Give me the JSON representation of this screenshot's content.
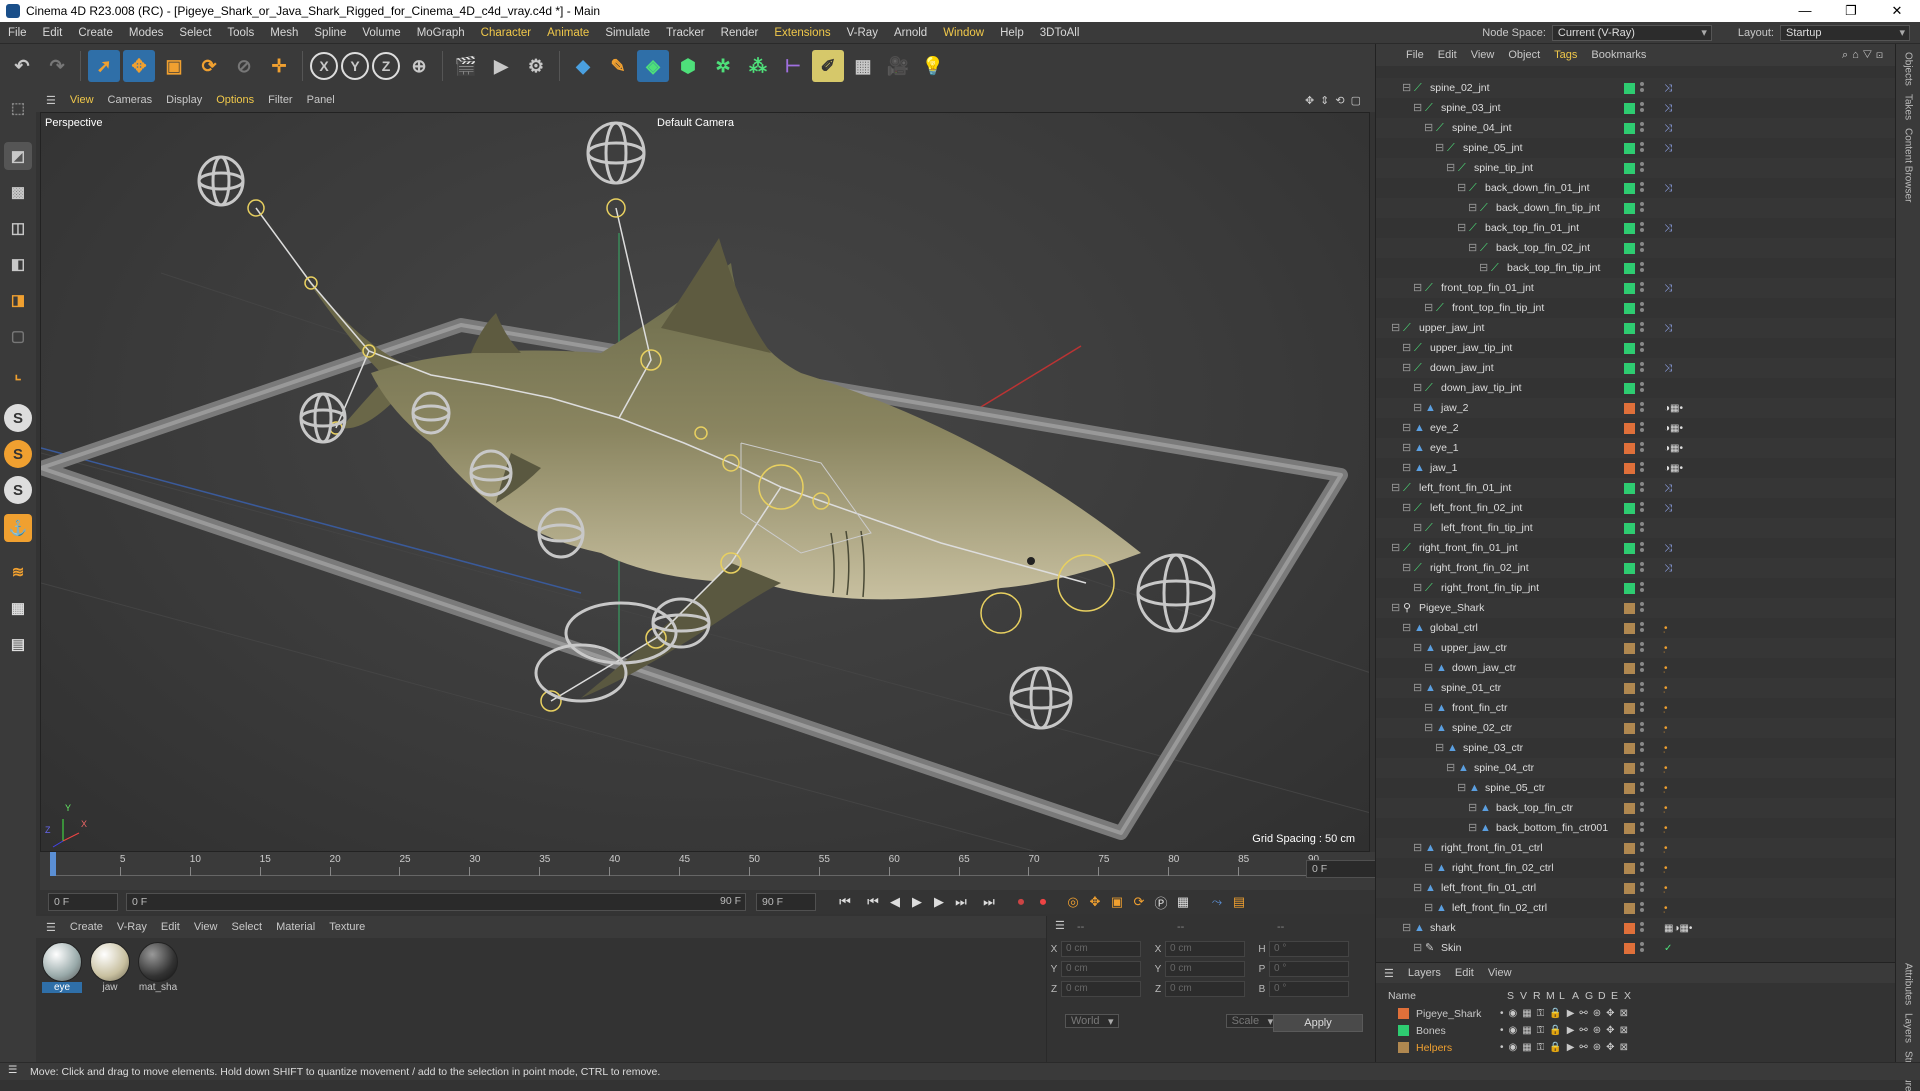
{
  "window": {
    "title": "Cinema 4D R23.008 (RC) - [Pigeye_Shark_or_Java_Shark_Rigged_for_Cinema_4D_c4d_vray.c4d *] - Main",
    "controls": [
      "—",
      "❐",
      "✕"
    ]
  },
  "menubar": {
    "items": [
      "File",
      "Edit",
      "Create",
      "Modes",
      "Select",
      "Tools",
      "Mesh",
      "Spline",
      "Volume",
      "MoGraph",
      "Character",
      "Animate",
      "Simulate",
      "Tracker",
      "Render",
      "Extensions",
      "V-Ray",
      "Arnold",
      "Window",
      "Help",
      "3DToAll"
    ],
    "node_space_label": "Node Space:",
    "node_space_value": "Current (V-Ray)",
    "layout_label": "Layout:",
    "layout_value": "Startup"
  },
  "viewport": {
    "menu": [
      "View",
      "Cameras",
      "Display",
      "Options",
      "Filter",
      "Panel"
    ],
    "name": "Perspective",
    "camera": "Default Camera",
    "grid_spacing": "Grid Spacing : 50 cm",
    "axis_x": "X",
    "axis_y": "Y",
    "axis_z": "Z"
  },
  "timeline": {
    "ticks": [
      "0",
      "5",
      "10",
      "15",
      "20",
      "25",
      "30",
      "35",
      "40",
      "45",
      "50",
      "55",
      "60",
      "65",
      "70",
      "75",
      "80",
      "85",
      "90"
    ],
    "current_frame": "0 F",
    "start": "0 F",
    "range_start": "0 F",
    "range_end": "90 F",
    "end": "90 F"
  },
  "materials": {
    "menu": [
      "Create",
      "V-Ray",
      "Edit",
      "View",
      "Select",
      "Material",
      "Texture"
    ],
    "items": [
      {
        "name": "eye",
        "color": "#cfd8d8"
      },
      {
        "name": "jaw",
        "color": "#d8d0a8"
      },
      {
        "name": "mat_sha",
        "color": "#3a3a3a"
      }
    ]
  },
  "coords": {
    "header": [
      "--",
      "--",
      "--"
    ],
    "rows": [
      {
        "l1": "X",
        "v1": "0 cm",
        "l2": "X",
        "v2": "0 cm",
        "l3": "H",
        "v3": "0 °"
      },
      {
        "l1": "Y",
        "v1": "0 cm",
        "l2": "Y",
        "v2": "0 cm",
        "l3": "P",
        "v3": "0 °"
      },
      {
        "l1": "Z",
        "v1": "0 cm",
        "l2": "Z",
        "v2": "0 cm",
        "l3": "B",
        "v3": "0 °"
      }
    ],
    "world": "World",
    "scale": "Scale",
    "apply": "Apply"
  },
  "objects": {
    "menu": [
      "File",
      "Edit",
      "View",
      "Object",
      "Tags",
      "Bookmarks"
    ],
    "rows": [
      {
        "name": "spine_02_jnt",
        "depth": 2,
        "type": "joint",
        "lay": "#2ecc71",
        "tag": "ik"
      },
      {
        "name": "spine_03_jnt",
        "depth": 3,
        "type": "joint",
        "lay": "#2ecc71",
        "tag": "ik"
      },
      {
        "name": "spine_04_jnt",
        "depth": 4,
        "type": "joint",
        "lay": "#2ecc71",
        "tag": "ik"
      },
      {
        "name": "spine_05_jnt",
        "depth": 5,
        "type": "joint",
        "lay": "#2ecc71",
        "tag": "ik"
      },
      {
        "name": "spine_tip_jnt",
        "depth": 6,
        "type": "joint",
        "lay": "#2ecc71",
        "tag": ""
      },
      {
        "name": "back_down_fin_01_jnt",
        "depth": 7,
        "type": "joint",
        "lay": "#2ecc71",
        "tag": "ik"
      },
      {
        "name": "back_down_fin_tip_jnt",
        "depth": 8,
        "type": "joint",
        "lay": "#2ecc71",
        "tag": ""
      },
      {
        "name": "back_top_fin_01_jnt",
        "depth": 7,
        "type": "joint",
        "lay": "#2ecc71",
        "tag": "ik"
      },
      {
        "name": "back_top_fin_02_jnt",
        "depth": 8,
        "type": "joint",
        "lay": "#2ecc71",
        "tag": ""
      },
      {
        "name": "back_top_fin_tip_jnt",
        "depth": 9,
        "type": "joint",
        "lay": "#2ecc71",
        "tag": ""
      },
      {
        "name": "front_top_fin_01_jnt",
        "depth": 3,
        "type": "joint",
        "lay": "#2ecc71",
        "tag": "ik"
      },
      {
        "name": "front_top_fin_tip_jnt",
        "depth": 4,
        "type": "joint",
        "lay": "#2ecc71",
        "tag": ""
      },
      {
        "name": "upper_jaw_jnt",
        "depth": 1,
        "type": "joint",
        "lay": "#2ecc71",
        "tag": "ik"
      },
      {
        "name": "upper_jaw_tip_jnt",
        "depth": 2,
        "type": "joint",
        "lay": "#2ecc71",
        "tag": ""
      },
      {
        "name": "down_jaw_jnt",
        "depth": 2,
        "type": "joint",
        "lay": "#2ecc71",
        "tag": "ik"
      },
      {
        "name": "down_jaw_tip_jnt",
        "depth": 3,
        "type": "joint",
        "lay": "#2ecc71",
        "tag": ""
      },
      {
        "name": "jaw_2",
        "depth": 3,
        "type": "mesh",
        "lay": "#e0703a",
        "tag": "mat"
      },
      {
        "name": "eye_2",
        "depth": 2,
        "type": "mesh",
        "lay": "#e0703a",
        "tag": "mat"
      },
      {
        "name": "eye_1",
        "depth": 2,
        "type": "mesh",
        "lay": "#e0703a",
        "tag": "mat"
      },
      {
        "name": "jaw_1",
        "depth": 2,
        "type": "mesh",
        "lay": "#e0703a",
        "tag": "mat"
      },
      {
        "name": "left_front_fin_01_jnt",
        "depth": 1,
        "type": "joint",
        "lay": "#2ecc71",
        "tag": "ik"
      },
      {
        "name": "left_front_fin_02_jnt",
        "depth": 2,
        "type": "joint",
        "lay": "#2ecc71",
        "tag": "ik"
      },
      {
        "name": "left_front_fin_tip_jnt",
        "depth": 3,
        "type": "joint",
        "lay": "#2ecc71",
        "tag": ""
      },
      {
        "name": "right_front_fin_01_jnt",
        "depth": 1,
        "type": "joint",
        "lay": "#2ecc71",
        "tag": "ik"
      },
      {
        "name": "right_front_fin_02_jnt",
        "depth": 2,
        "type": "joint",
        "lay": "#2ecc71",
        "tag": "ik"
      },
      {
        "name": "right_front_fin_tip_jnt",
        "depth": 3,
        "type": "joint",
        "lay": "#2ecc71",
        "tag": ""
      },
      {
        "name": "Pigeye_Shark",
        "depth": 1,
        "type": "null",
        "lay": "#b08850",
        "tag": ""
      },
      {
        "name": "global_ctrl",
        "depth": 2,
        "type": "ctrl",
        "lay": "#b08850",
        "tag": "ctl"
      },
      {
        "name": "upper_jaw_ctr",
        "depth": 3,
        "type": "ctrl",
        "lay": "#b08850",
        "tag": "ctl"
      },
      {
        "name": "down_jaw_ctr",
        "depth": 4,
        "type": "ctrl",
        "lay": "#b08850",
        "tag": "ctl"
      },
      {
        "name": "spine_01_ctr",
        "depth": 3,
        "type": "ctrl",
        "lay": "#b08850",
        "tag": "ctl"
      },
      {
        "name": "front_fin_ctr",
        "depth": 4,
        "type": "ctrl",
        "lay": "#b08850",
        "tag": "ctl"
      },
      {
        "name": "spine_02_ctr",
        "depth": 4,
        "type": "ctrl",
        "lay": "#b08850",
        "tag": "ctl"
      },
      {
        "name": "spine_03_ctr",
        "depth": 5,
        "type": "ctrl",
        "lay": "#b08850",
        "tag": "ctl"
      },
      {
        "name": "spine_04_ctr",
        "depth": 6,
        "type": "ctrl",
        "lay": "#b08850",
        "tag": "ctl"
      },
      {
        "name": "spine_05_ctr",
        "depth": 7,
        "type": "ctrl",
        "lay": "#b08850",
        "tag": "ctl"
      },
      {
        "name": "back_top_fin_ctr",
        "depth": 8,
        "type": "ctrl",
        "lay": "#b08850",
        "tag": "ctl"
      },
      {
        "name": "back_bottom_fin_ctr001",
        "depth": 8,
        "type": "ctrl",
        "lay": "#b08850",
        "tag": "ctl"
      },
      {
        "name": "right_front_fin_01_ctrl",
        "depth": 3,
        "type": "ctrl",
        "lay": "#b08850",
        "tag": "ctl"
      },
      {
        "name": "right_front_fin_02_ctrl",
        "depth": 4,
        "type": "ctrl",
        "lay": "#b08850",
        "tag": "ctl"
      },
      {
        "name": "left_front_fin_01_ctrl",
        "depth": 3,
        "type": "ctrl",
        "lay": "#b08850",
        "tag": "ctl"
      },
      {
        "name": "left_front_fin_02_ctrl",
        "depth": 4,
        "type": "ctrl",
        "lay": "#b08850",
        "tag": "ctl"
      },
      {
        "name": "shark",
        "depth": 2,
        "type": "mesh",
        "lay": "#e0703a",
        "tag": "multi"
      },
      {
        "name": "Skin",
        "depth": 3,
        "type": "skin",
        "lay": "#e0703a",
        "tag": "check"
      }
    ]
  },
  "layers": {
    "menu": [
      "Layers",
      "Edit",
      "View"
    ],
    "columns": [
      "Name",
      "S",
      "V",
      "R",
      "M",
      "L",
      "A",
      "G",
      "D",
      "E",
      "X"
    ],
    "items": [
      {
        "name": "Pigeye_Shark",
        "color": "#e0703a"
      },
      {
        "name": "Bones",
        "color": "#2ecc71"
      },
      {
        "name": "Helpers",
        "color": "#b08850"
      }
    ]
  },
  "side_tabs": [
    "Objects",
    "Takes",
    "Content Browser",
    "Attributes",
    "Layers",
    "Structure"
  ],
  "status": "Move: Click and drag to move elements. Hold down SHIFT to quantize movement / add to the selection in point mode, CTRL to remove."
}
